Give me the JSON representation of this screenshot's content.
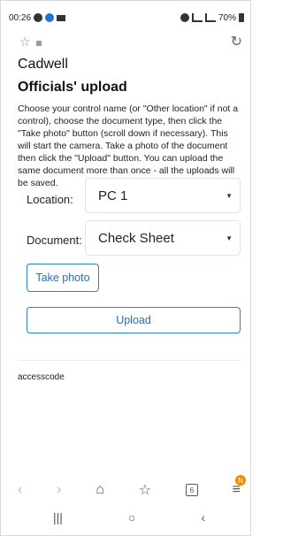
{
  "status": {
    "time": "00:26",
    "battery_text": "70%"
  },
  "browser": {
    "star_icon": "star-outline-icon",
    "lock_icon": "lock-icon",
    "reload_icon": "reload-icon"
  },
  "page": {
    "app_title": "Cadwell",
    "title": "Officials' upload",
    "instructions": "Choose your control name (or \"Other location\" if not a control), choose the document type, then click the \"Take photo\" button (scroll down if necessary). This will start the camera. Take a photo of the document then click the \"Upload\" button. You can upload the same document more than once - all the uploads will be saved.",
    "location_label": "Location:",
    "location_value": "PC 1",
    "document_label": "Document:",
    "document_value": "Check Sheet",
    "take_photo_label": "Take photo",
    "upload_label": "Upload",
    "access_text": "accesscode"
  },
  "toolbar": {
    "badge": "N"
  },
  "colors": {
    "accent": "#2f7fd1",
    "badge": "#f08c00"
  }
}
